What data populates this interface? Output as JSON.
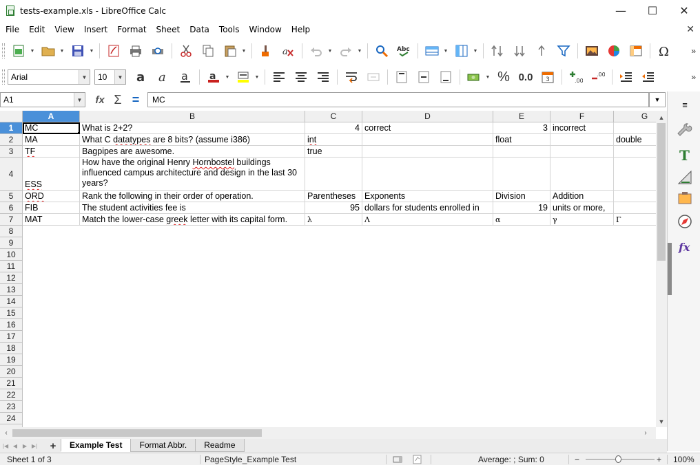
{
  "window": {
    "title": "tests-example.xls - LibreOffice Calc",
    "minimize": "—",
    "maximize": "☐",
    "close": "✕"
  },
  "menu": [
    "File",
    "Edit",
    "View",
    "Insert",
    "Format",
    "Sheet",
    "Data",
    "Tools",
    "Window",
    "Help"
  ],
  "menu_close": "✕",
  "format_toolbar": {
    "font_name": "Arial",
    "font_size": "10",
    "percent": "%",
    "decimal": "0.0"
  },
  "formula_bar": {
    "cell_ref": "A1",
    "content": "MC"
  },
  "columns": [
    "A",
    "B",
    "C",
    "D",
    "E",
    "F",
    "G"
  ],
  "rows": [
    "1",
    "2",
    "3",
    "4",
    "5",
    "6",
    "7",
    "8",
    "9",
    "10",
    "11",
    "12",
    "13",
    "14",
    "15",
    "16",
    "17",
    "18",
    "19",
    "20",
    "21",
    "22",
    "23",
    "24"
  ],
  "cells": {
    "r1": {
      "A": "MC",
      "B": "What is 2+2?",
      "C": "4",
      "D": "correct",
      "E": "3",
      "F": "incorrect"
    },
    "r2": {
      "A": "MA",
      "B_pre": "What C ",
      "B_err": "datatypes",
      "B_post": " are 8 bits? (assume i386)",
      "C": "int",
      "E": "float",
      "G": "double"
    },
    "r3": {
      "A": "TF",
      "B": "Bagpipes are awesome.",
      "C": "true"
    },
    "r4": {
      "A": "ESS",
      "B_pre": "How have the original Henry ",
      "B_err": "Hornbostel",
      "B_post": " buildings influenced campus architecture and design in the last 30 years?"
    },
    "r5": {
      "A": "ORD",
      "B": "Rank the following in their order of operation.",
      "C": "Parentheses",
      "D": "Exponents",
      "E": "Division",
      "F": "Addition"
    },
    "r6": {
      "A": "FIB",
      "B": "The student activities fee is",
      "C": "95",
      "D": "dollars for students enrolled in",
      "E": "19",
      "F": "units or more,"
    },
    "r7": {
      "A": "MAT",
      "B_pre": "Match the lower-case ",
      "B_err": "greek",
      "B_post": " letter with its capital form.",
      "C": "λ",
      "D": "Λ",
      "E": "α",
      "F": "γ",
      "G": "Γ"
    }
  },
  "sheet_tabs": [
    "Example Test",
    "Format Abbr.",
    "Readme"
  ],
  "tab_add": "+",
  "status": {
    "sheet": "Sheet 1 of 3",
    "page_style": "PageStyle_Example Test",
    "summary": "Average: ; Sum: 0",
    "zoom": "100%",
    "zoom_minus": "−",
    "zoom_plus": "+"
  },
  "colors": {
    "selection_header": "#4a90d9",
    "spellcheck": "#e02020"
  }
}
